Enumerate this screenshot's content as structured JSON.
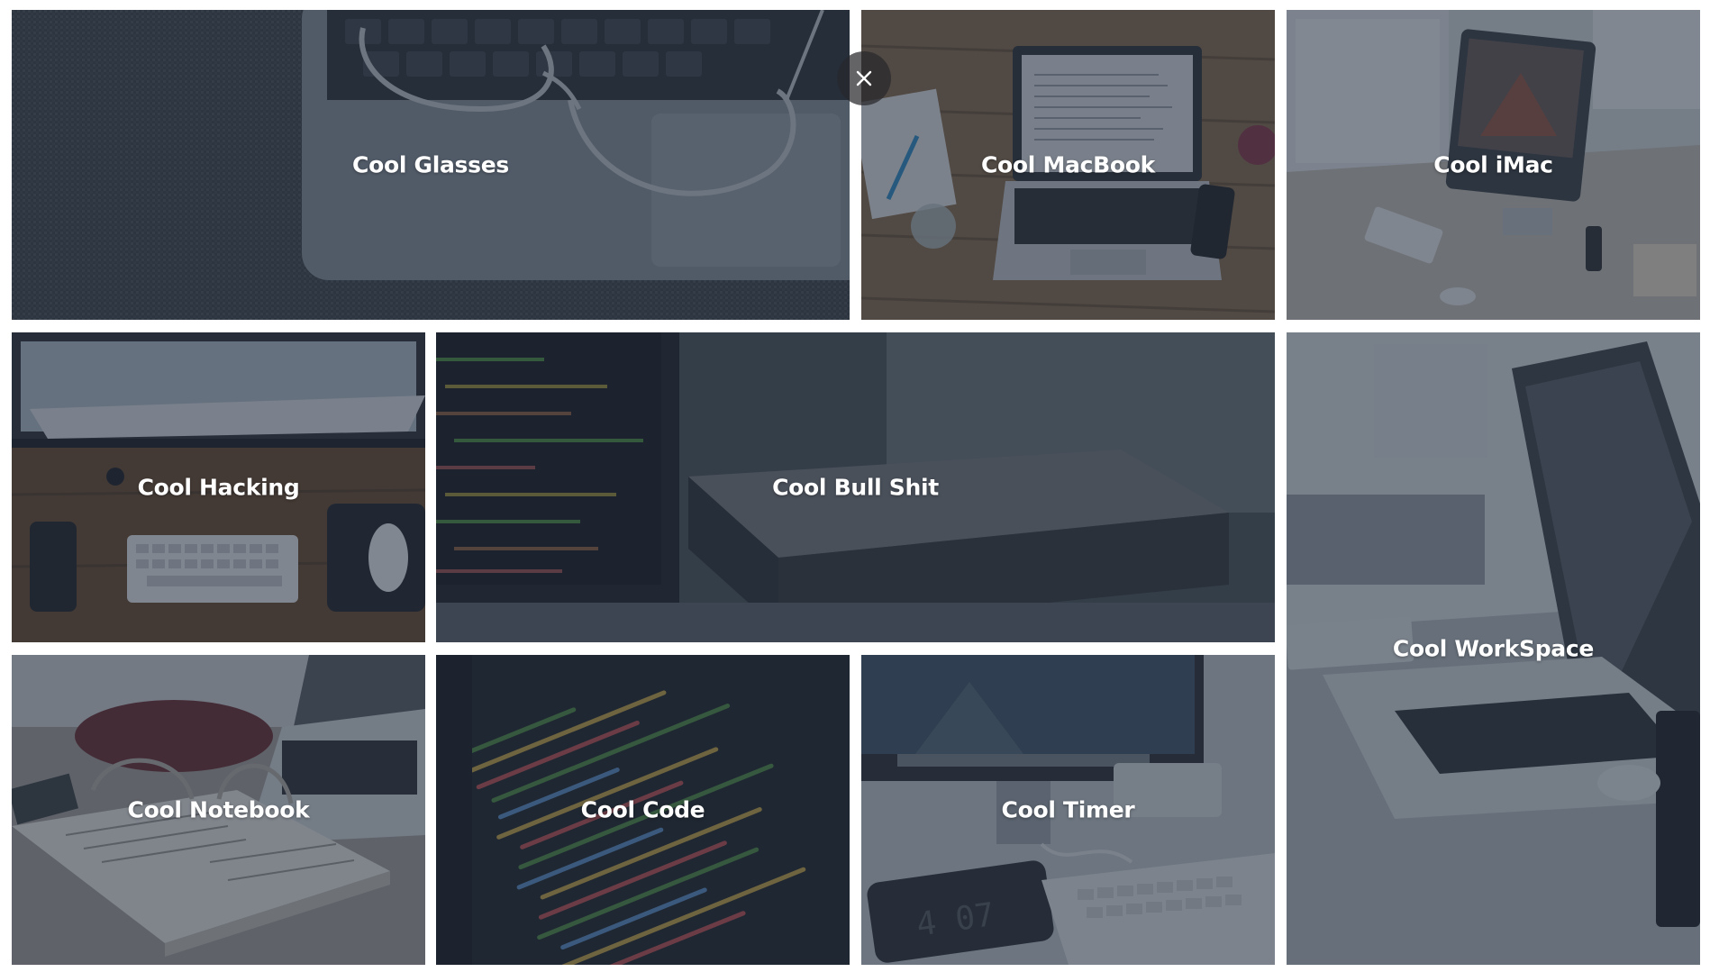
{
  "gallery": {
    "tiles": [
      {
        "caption": "Cool Glasses"
      },
      {
        "caption": "Cool MacBook"
      },
      {
        "caption": "Cool iMac"
      },
      {
        "caption": "Cool Hacking"
      },
      {
        "caption": "Cool Bull Shit"
      },
      {
        "caption": "Cool WorkSpace"
      },
      {
        "caption": "Cool Notebook"
      },
      {
        "caption": "Cool Code"
      },
      {
        "caption": "Cool Timer"
      }
    ]
  },
  "close_button": {
    "icon": "close-icon"
  },
  "colors": {
    "overlay": "#222e3e",
    "caption_text": "#ffffff",
    "page_background": "#ffffff"
  }
}
